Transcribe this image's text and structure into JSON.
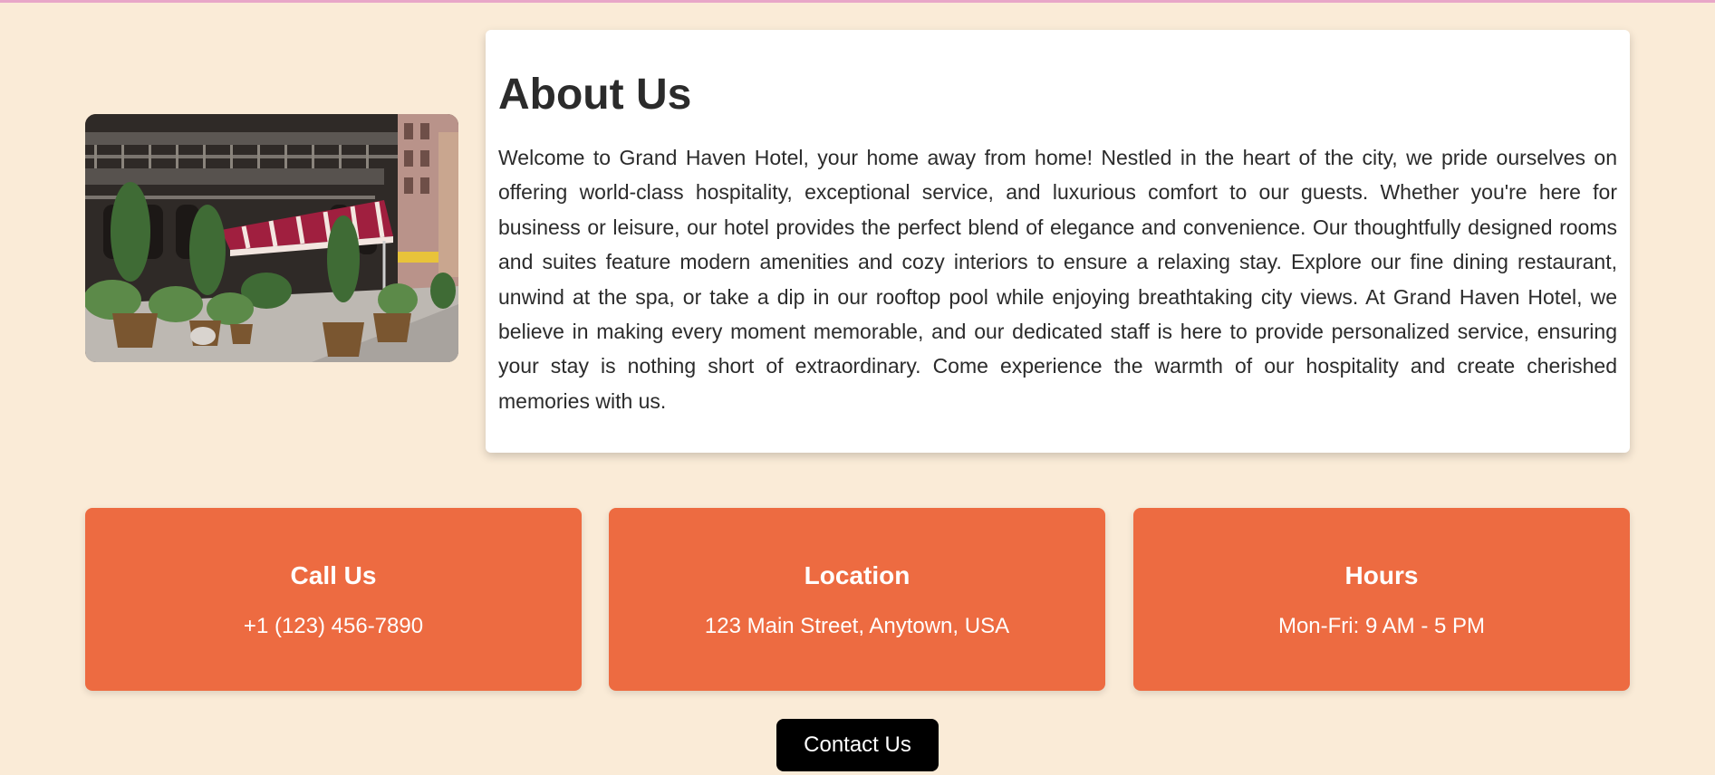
{
  "about": {
    "title": "About Us",
    "paragraph": "Welcome to Grand Haven Hotel, your home away from home! Nestled in the heart of the city, we pride ourselves on offering world-class hospitality, exceptional service, and luxurious comfort to our guests. Whether you're here for business or leisure, our hotel provides the perfect blend of elegance and convenience. Our thoughtfully designed rooms and suites feature modern amenities and cozy interiors to ensure a relaxing stay. Explore our fine dining restaurant, unwind at the spa, or take a dip in our rooftop pool while enjoying breathtaking city views. At Grand Haven Hotel, we believe in making every moment memorable, and our dedicated staff is here to provide personalized service, ensuring your stay is nothing short of extraordinary. Come experience the warmth of our hospitality and create cherished memories with us."
  },
  "info_cards": [
    {
      "title": "Call Us",
      "value": "+1 (123) 456-7890"
    },
    {
      "title": "Location",
      "value": "123 Main Street, Anytown, USA"
    },
    {
      "title": "Hours",
      "value": "Mon-Fri: 9 AM - 5 PM"
    }
  ],
  "contact_button": {
    "label": "Contact Us"
  },
  "colors": {
    "page_background": "#FAEBD7",
    "card_accent": "#ED6B41",
    "button": "#000000",
    "awning": "#A01F3F"
  }
}
